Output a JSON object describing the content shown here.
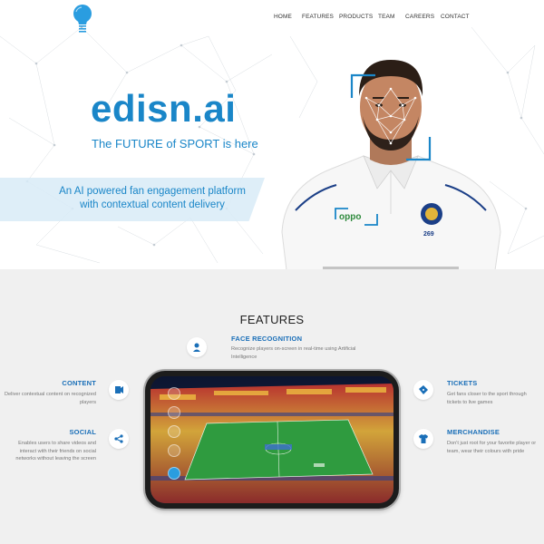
{
  "nav": {
    "items": [
      "HOME",
      "FEATURES",
      "PRODUCTS",
      "TEAM",
      "CAREERS",
      "CONTACT"
    ]
  },
  "hero": {
    "brand": "edisn.ai",
    "tagline": "The FUTURE of SPORT is here",
    "subtitle_line1": "An AI powered fan engagement platform",
    "subtitle_line2": "with contextual content delivery",
    "jersey_brand": "oppo",
    "jersey_number": "269"
  },
  "features": {
    "title": "FEATURES",
    "face_recognition": {
      "heading": "FACE RECOGNITION",
      "desc1": "Recognize players on-screen in real-time using Artificial",
      "desc2": "Intelligence",
      "icon": "face-scan-icon"
    },
    "content": {
      "heading": "CONTENT",
      "desc1": "Deliver contextual content on recognized",
      "desc2": "players",
      "icon": "content-icon"
    },
    "social": {
      "heading": "SOCIAL",
      "desc1": "Enables users to share videos and",
      "desc2": "interact with their friends on social",
      "desc3": "networks without leaving the screen",
      "icon": "share-icon"
    },
    "tickets": {
      "heading": "TICKETS",
      "desc1": "Get fans closer to the sport through",
      "desc2": "tickets to live games",
      "icon": "ticket-icon"
    },
    "merchandise": {
      "heading": "MERCHANDISE",
      "desc1": "Don't just root for your favorite player or",
      "desc2": "team, wear their colours with pride",
      "icon": "tshirt-icon"
    }
  },
  "colors": {
    "brand_blue": "#1a86c8",
    "heading_blue": "#1a6fb8",
    "features_bg": "#f0f0f0"
  }
}
